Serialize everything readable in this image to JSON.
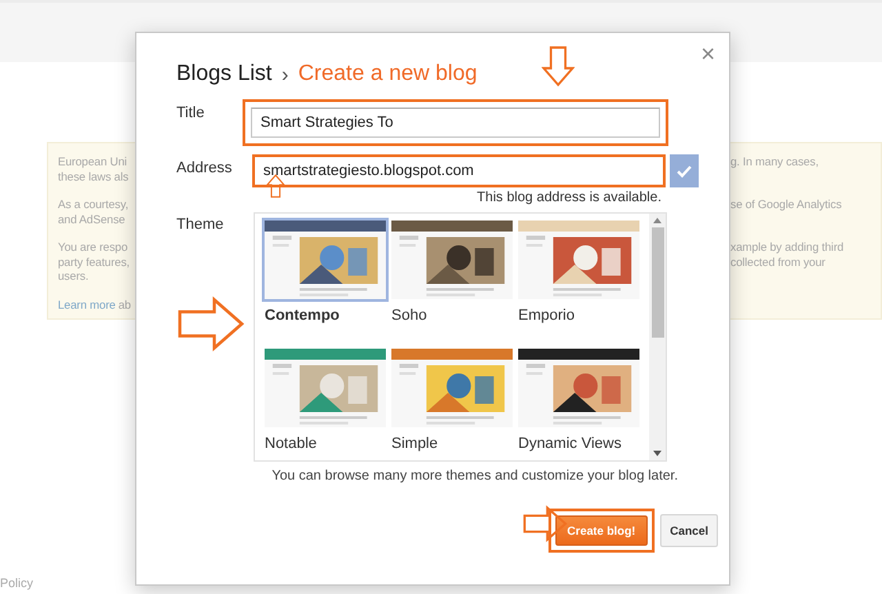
{
  "page": {
    "notice": {
      "paragraphs": [
        {
          "left": [
            "European Uni",
            "these laws als"
          ],
          "right": [
            "g. In many cases,"
          ]
        },
        {
          "left": [
            "As a courtesy,",
            "and AdSense"
          ],
          "right": [
            "se of Google Analytics"
          ]
        },
        {
          "left": [
            "You are respo",
            "party features,",
            "users."
          ],
          "right": [
            "xample by adding third",
            "collected from your"
          ]
        },
        {
          "link": "Learn more",
          "left": [
            "ab"
          ]
        }
      ]
    },
    "footer": "Policy"
  },
  "dialog": {
    "breadcrumb": {
      "parent": "Blogs List",
      "separator": "›",
      "current": "Create a new blog"
    },
    "close": "×",
    "title": {
      "label": "Title",
      "value": "Smart Strategies To"
    },
    "address": {
      "label": "Address",
      "value": "smartstrategiesto.blogspot.com",
      "available": true,
      "message": "This blog address is available."
    },
    "theme": {
      "label": "Theme",
      "themes": [
        {
          "name": "Contempo",
          "selected": true
        },
        {
          "name": "Soho",
          "selected": false
        },
        {
          "name": "Emporio",
          "selected": false
        },
        {
          "name": "Notable",
          "selected": false
        },
        {
          "name": "Simple",
          "selected": false
        },
        {
          "name": "Dynamic Views",
          "selected": false
        }
      ]
    },
    "hint": "You can browse many more themes and customize your blog later.",
    "buttons": [
      {
        "label": "Create blog!",
        "kind": "primary"
      },
      {
        "label": "Cancel",
        "kind": "secondary"
      }
    ]
  }
}
